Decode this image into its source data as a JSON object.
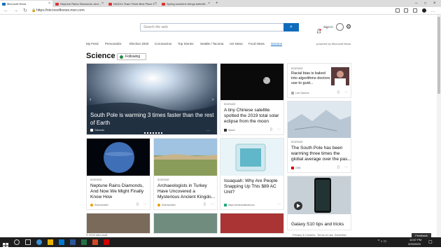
{
  "browser": {
    "tabs": [
      {
        "label": "Microsoft News",
        "active": true
      },
      {
        "label": "Neptune Rains Diamonds, And..."
      },
      {
        "label": "NASA's Team Finds Best Place F..."
      },
      {
        "label": "Spring sunshine brings butterfli..."
      }
    ],
    "url": "https://microsoftnews.msn.com"
  },
  "search": {
    "placeholder": "Search the web",
    "button_icon": "search-icon"
  },
  "account": {
    "sign_in": "Sign in"
  },
  "nav": {
    "items": [
      "My Feed",
      "Personalize",
      "Election 2020",
      "Coronavirus",
      "Top Stories",
      "Seattle / Tacoma",
      "US News",
      "Food News",
      "Science"
    ],
    "active": "Science",
    "powered": "powered by Microsoft News"
  },
  "section": {
    "title": "Science",
    "follow_label": "Following"
  },
  "hero": {
    "title": "South Pole is warming 3 times faster than the rest of Earth",
    "source": "Gizmodo"
  },
  "cards": [
    {
      "category": "SCIENCE",
      "title": "A tiny Chinese satellite spotted the 2019 total solar eclipse from the moon",
      "source": "Space"
    },
    {
      "category": "SCIENCE",
      "title": "Racial bias is baked into algorithms doctors use to guid...",
      "source": "Live Science"
    },
    {
      "category": "SCIENCE",
      "title": "The South Pole has been warming three times the global average over the pas...",
      "source": "CNN"
    },
    {
      "category": "SCIENCE",
      "title": "Neptune Rains Diamonds, And Now We Might Finally Know How",
      "source": "ScienceAlert"
    },
    {
      "category": "SCIENCE",
      "title": "Archaeologists in Turkey Have Uncovered a Mysterious Ancient Kingdo...",
      "source": "ScienceAlert"
    },
    {
      "category": "SCIENCE",
      "title": "Issaquah: Why Are People Snapping Up This $89 AC Unit?",
      "source": "https://arcticsmithaircool"
    },
    {
      "category": "",
      "title": "Galaxy S10 tips and tricks",
      "source": ""
    }
  ],
  "footer": {
    "copyright": "© 2020 Microsoft",
    "links": [
      "Privacy & Cookies",
      "Terms of use",
      "Advertise"
    ],
    "feedback": "Feedback"
  },
  "taskbar": {
    "time": "10:57 PM",
    "date": "3/29/2020"
  }
}
